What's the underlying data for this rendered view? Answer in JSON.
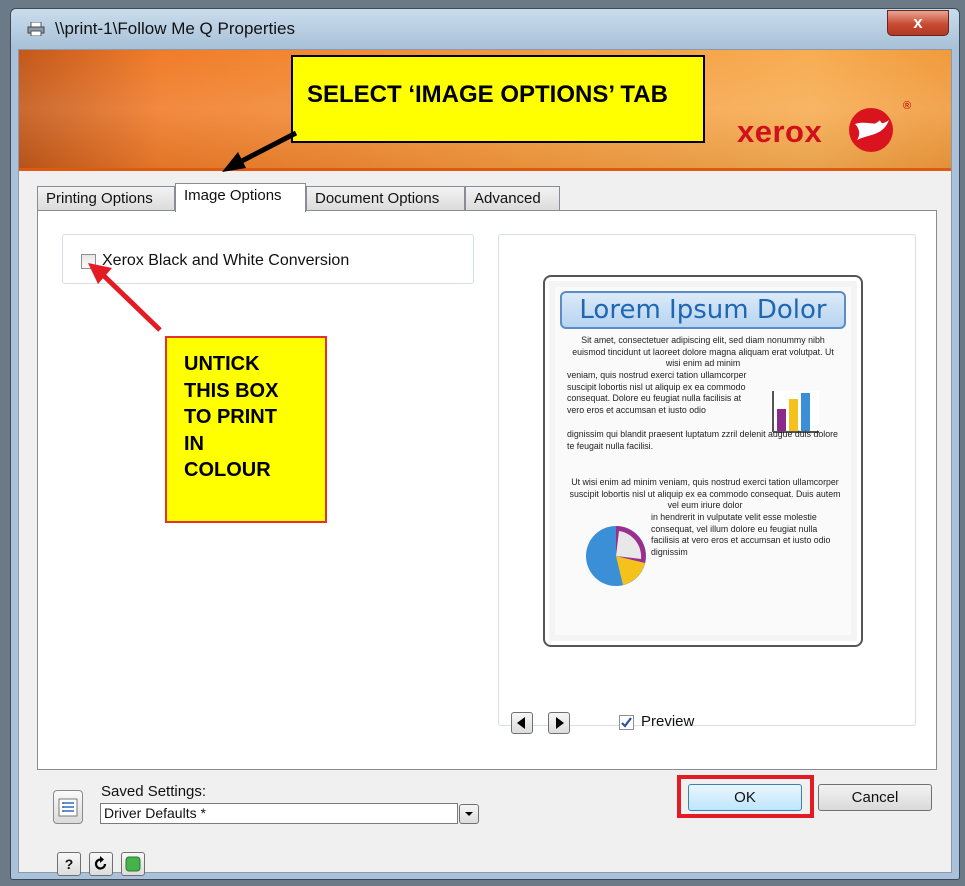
{
  "window": {
    "title": "\\\\print-1\\Follow Me Q Properties",
    "close_glyph": "x"
  },
  "banner": {
    "logo_text": "xerox",
    "reg_mark": "®"
  },
  "annotations": {
    "top_callout": "SELECT ‘IMAGE OPTIONS’ TAB",
    "left_callout": "UNTICK\nTHIS BOX\nTO PRINT\nIN\nCOLOUR",
    "callout_color": "#ffff00",
    "highlight_color": "#e31b23"
  },
  "tabs": [
    {
      "label": "Printing Options",
      "active": false
    },
    {
      "label": "Image Options",
      "active": true
    },
    {
      "label": "Document Options",
      "active": false
    },
    {
      "label": "Advanced",
      "active": false
    }
  ],
  "image_options": {
    "bw_conversion_label": "Xerox Black and White Conversion",
    "bw_conversion_checked": false
  },
  "preview": {
    "heading": "Lorem Ipsum Dolor",
    "para1_full": "Sit amet, consectetuer adipiscing elit, sed diam nonummy nibh euismod tincidunt ut laoreet dolore magna aliquam erat volutpat. Ut wisi enim ad minim",
    "para1_wrap": "veniam, quis nostrud exerci tation ullamcorper suscipit lobortis nisl ut aliquip ex ea commodo consequat. Dolore eu feugiat nulla facilisis at vero eros et accumsan et iusto odio",
    "para1_end": "dignissim qui blandit praesent luptatum zzril delenit augue duis dolore te feugait nulla facilisi.",
    "para2_full": "Ut wisi enim ad minim veniam, quis nostrud exerci tation ullamcorper suscipit lobortis nisl ut aliquip ex ea commodo consequat. Duis autem vel eum iriure dolor",
    "para2_wrap": "in hendrerit in vulputate velit esse molestie consequat, vel illum dolore eu feugiat nulla facilisis at vero eros et accumsan et iusto odio dignissim",
    "preview_label": "Preview",
    "preview_checked": true
  },
  "saved_settings": {
    "label": "Saved Settings:",
    "value": "Driver Defaults *"
  },
  "footer": {
    "help_label": "?",
    "ok_label": "OK",
    "cancel_label": "Cancel"
  }
}
